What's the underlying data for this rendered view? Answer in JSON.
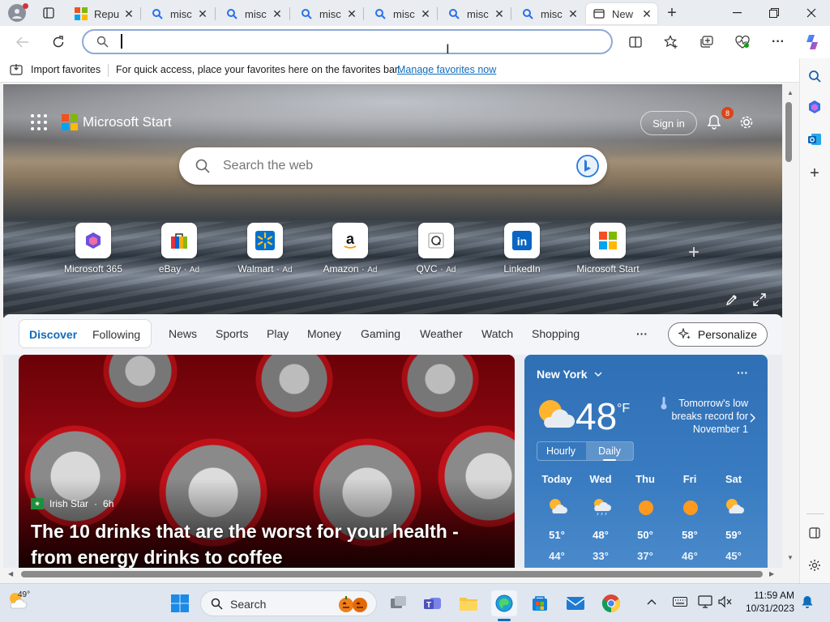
{
  "browser": {
    "tabs": [
      {
        "title": "Repu",
        "favicon": "microsoft-logo-icon"
      },
      {
        "title": "misc",
        "favicon": "search-icon"
      },
      {
        "title": "misc",
        "favicon": "search-icon"
      },
      {
        "title": "misc",
        "favicon": "search-icon"
      },
      {
        "title": "misc",
        "favicon": "search-icon"
      },
      {
        "title": "misc",
        "favicon": "search-icon"
      },
      {
        "title": "misc",
        "favicon": "search-icon"
      },
      {
        "title": "New",
        "favicon": "new-tab-icon",
        "active": true
      }
    ],
    "new_tab_symbol": "+",
    "address_value": "",
    "favorites_bar": {
      "import_label": "Import favorites",
      "hint": "For quick access, place your favorites here on the favorites bar.",
      "manage_link": "Manage favorites now"
    }
  },
  "start": {
    "brand": "Microsoft Start",
    "sign_in": "Sign in",
    "notifications_count": "8",
    "search_placeholder": "Search the web",
    "quick_links": [
      {
        "label": "Microsoft 365",
        "ad": ""
      },
      {
        "label": "eBay",
        "ad": "Ad"
      },
      {
        "label": "Walmart",
        "ad": "Ad"
      },
      {
        "label": "Amazon",
        "ad": "Ad"
      },
      {
        "label": "QVC",
        "ad": "Ad"
      },
      {
        "label": "LinkedIn",
        "ad": ""
      },
      {
        "label": "Microsoft Start",
        "ad": ""
      }
    ],
    "nav": {
      "pill": [
        "Discover",
        "Following"
      ],
      "items": [
        "News",
        "Sports",
        "Play",
        "Money",
        "Gaming",
        "Weather",
        "Watch",
        "Shopping"
      ],
      "more": "···",
      "personalize": "Personalize"
    },
    "news_card": {
      "source": "Irish Star",
      "age": "6h",
      "headline": "The 10 drinks that are the worst for your health - from energy drinks to coffee"
    },
    "weather": {
      "location": "New York",
      "temp": "48",
      "unit": "°F",
      "alert": "Tomorrow's low breaks record for November 1",
      "tabs": [
        "Hourly",
        "Daily"
      ],
      "days": [
        {
          "day": "Today",
          "icon": "partly-cloudy-icon",
          "high": "51°",
          "low": "44°"
        },
        {
          "day": "Wed",
          "icon": "rain-cloud-icon",
          "high": "48°",
          "low": "33°"
        },
        {
          "day": "Thu",
          "icon": "sun-icon",
          "high": "50°",
          "low": "37°"
        },
        {
          "day": "Fri",
          "icon": "sun-icon",
          "high": "58°",
          "low": "46°"
        },
        {
          "day": "Sat",
          "icon": "partly-cloudy-icon",
          "high": "59°",
          "low": "45°"
        }
      ]
    }
  },
  "taskbar": {
    "weather_temp": "49°",
    "search_label": "Search",
    "time": "11:59 AM",
    "date": "10/31/2023"
  },
  "colors": {
    "accent": "#0f6cbd",
    "weather_bg": "#3574ba",
    "notification_badge": "#d9461a"
  }
}
